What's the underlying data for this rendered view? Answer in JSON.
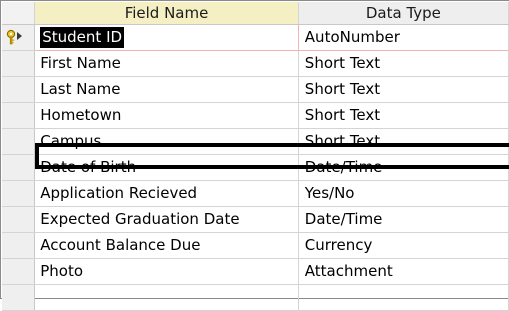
{
  "table": {
    "headers": {
      "field_name": "Field Name",
      "data_type": "Data Type"
    },
    "rows": [
      {
        "field": "Student ID",
        "type": "AutoNumber",
        "is_key": true
      },
      {
        "field": "First Name",
        "type": "Short Text"
      },
      {
        "field": "Last Name",
        "type": "Short Text"
      },
      {
        "field": "Hometown",
        "type": "Short Text"
      },
      {
        "field": "Campus",
        "type": "Short Text",
        "outlined": true
      },
      {
        "field": "Date of Birth",
        "type": "Date/Time"
      },
      {
        "field": "Application Recieved",
        "type": "Yes/No"
      },
      {
        "field": "Expected Graduation Date",
        "type": "Date/Time"
      },
      {
        "field": "Account Balance Due",
        "type": "Currency"
      },
      {
        "field": "Photo",
        "type": "Attachment"
      },
      {
        "field": "",
        "type": ""
      }
    ]
  },
  "icons": {
    "primary_key": "key-icon"
  },
  "colors": {
    "header_field_highlight": "#f5f0c4",
    "selection_text_bg": "#000000",
    "current_row_border": "#f1b3b3",
    "outline": "#000000"
  }
}
